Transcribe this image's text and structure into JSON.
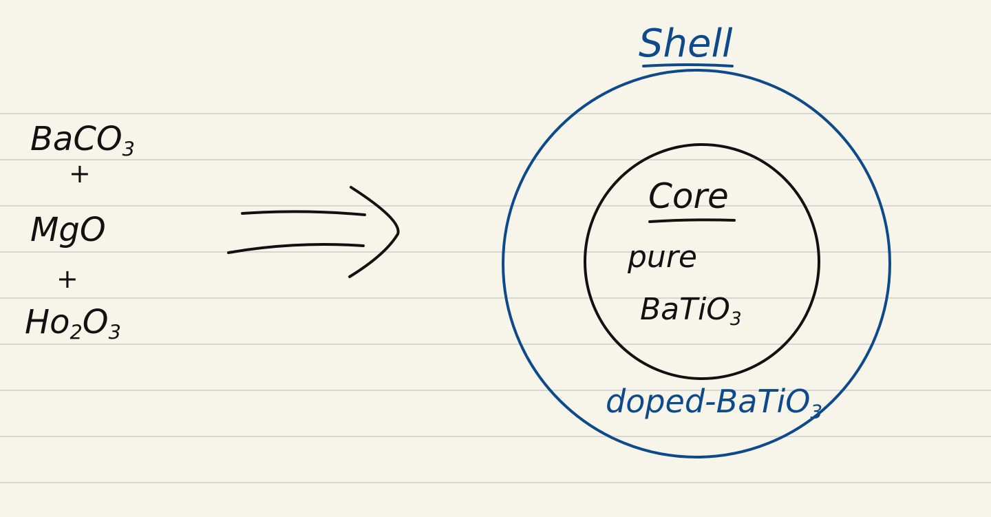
{
  "reactants": {
    "r1_main": "BaCO",
    "r1_sub": "3",
    "plus1": "+",
    "r2": "MgO",
    "plus2": "+",
    "r3_a": "Ho",
    "r3_sub1": "2",
    "r3_b": "O",
    "r3_sub2": "3"
  },
  "particle": {
    "shell_title": "Shell",
    "core_title": "Core",
    "core_line1": "pure",
    "core_line2_main": "BaTiO",
    "core_line2_sub": "3",
    "shell_label_main": "doped-BaTiO",
    "shell_label_sub": "3"
  },
  "colors": {
    "paper": "#f7f5ea",
    "ink": "#111111",
    "blue_ink": "#0d4a8c",
    "rule": "#d6d6d2"
  }
}
